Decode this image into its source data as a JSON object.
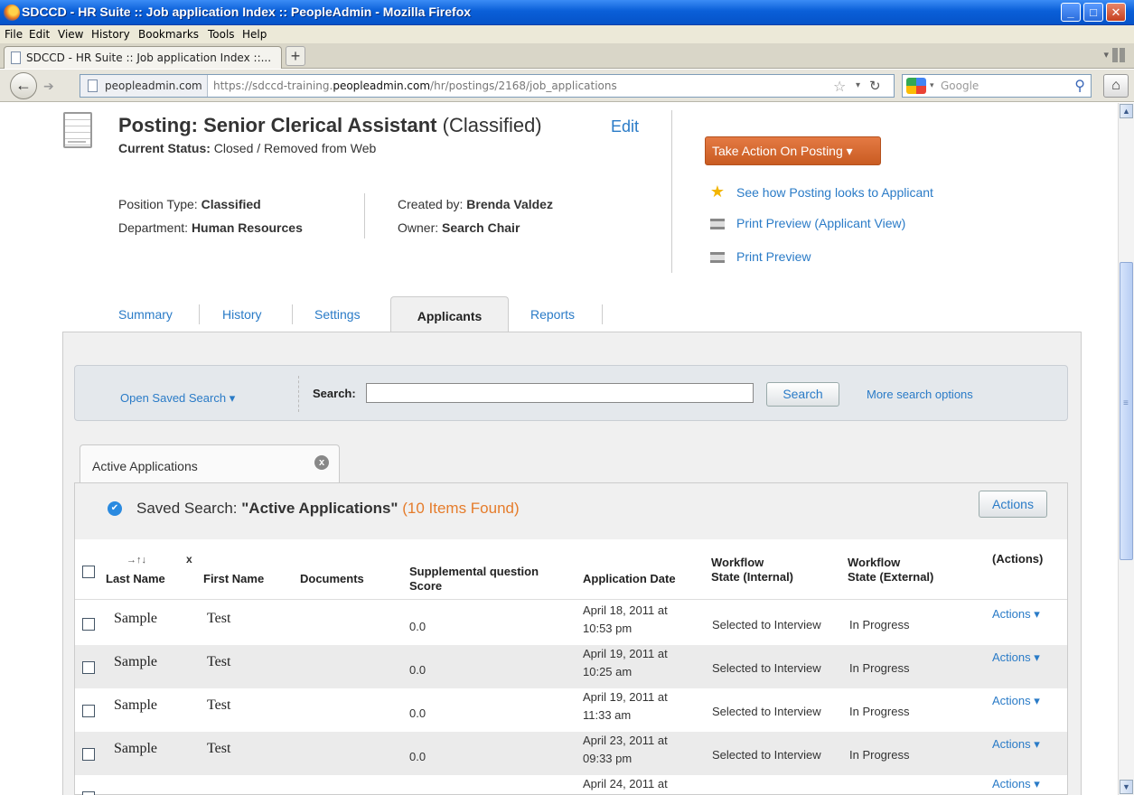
{
  "window": {
    "title": "SDCCD - HR Suite :: Job application Index :: PeopleAdmin - Mozilla Firefox",
    "min": "_",
    "max": "□",
    "close": "✕"
  },
  "menu": [
    "File",
    "Edit",
    "View",
    "History",
    "Bookmarks",
    "Tools",
    "Help"
  ],
  "browser_tab": {
    "label": "SDCCD - HR Suite :: Job application Index ::...",
    "new_tab": "+"
  },
  "nav": {
    "domain": "peopleadmin.com",
    "url_pre": "https://sdccd-training.",
    "url_host": "peopleadmin.com",
    "url_path": "/hr/postings/2168/job_applications",
    "search_placeholder": "Google"
  },
  "posting": {
    "title_prefix": "Posting: Senior Clerical Assistant",
    "title_suffix": " (Classified)",
    "edit": "Edit",
    "status_label": "Current Status:",
    "status_value": " Closed / Removed from Web",
    "position_type_label": "Position Type: ",
    "position_type": "Classified",
    "department_label": "Department: ",
    "department": "Human Resources",
    "created_by_label": "Created by: ",
    "created_by": "Brenda Valdez",
    "owner_label": "Owner: ",
    "owner": "Search Chair"
  },
  "side": {
    "take_action": "Take Action On Posting ▾",
    "links": [
      "See how Posting looks to Applicant",
      "Print Preview (Applicant View)",
      "Print Preview"
    ]
  },
  "tabs": [
    "Summary",
    "History",
    "Settings",
    "Applicants",
    "Reports"
  ],
  "search": {
    "open_saved": "Open Saved Search ▾",
    "label": "Search:",
    "value": "",
    "button": "Search",
    "more": "More search options"
  },
  "saved_tab": {
    "label": "Active Applications",
    "close": "x"
  },
  "results": {
    "prefix": "Saved Search: ",
    "name": "\"Active Applications\"",
    "count": " (10 Items Found)",
    "actions_button": "Actions"
  },
  "columns": {
    "sort_arrows": "→↑↓",
    "sort_clear": "x",
    "last_name": "Last Name",
    "first_name": "First Name",
    "documents": "Documents",
    "supp_score_1": "Supplemental question",
    "supp_score_2": "Score",
    "app_date": "Application Date",
    "wf_int_1": "Workflow",
    "wf_int_2": "State (Internal)",
    "wf_ext_1": "Workflow",
    "wf_ext_2": "State (External)",
    "actions": "(Actions)"
  },
  "rows": [
    {
      "last": "Sample",
      "first": "Test",
      "documents": "",
      "score": "0.0",
      "date1": "April 18, 2011 at",
      "date2": "10:53 pm",
      "wf_int": "Selected to Interview",
      "wf_ext": "In Progress",
      "action": "Actions ▾"
    },
    {
      "last": "Sample",
      "first": "Test",
      "documents": "",
      "score": "0.0",
      "date1": "April 19, 2011 at",
      "date2": "10:25 am",
      "wf_int": "Selected to Interview",
      "wf_ext": "In Progress",
      "action": "Actions ▾"
    },
    {
      "last": "Sample",
      "first": "Test",
      "documents": "",
      "score": "0.0",
      "date1": "April 19, 2011 at",
      "date2": "11:33 am",
      "wf_int": "Selected to Interview",
      "wf_ext": "In Progress",
      "action": "Actions ▾"
    },
    {
      "last": "Sample",
      "first": "Test",
      "documents": "",
      "score": "0.0",
      "date1": "April 23, 2011 at",
      "date2": "09:33 pm",
      "wf_int": "Selected to Interview",
      "wf_ext": "In Progress",
      "action": "Actions ▾"
    },
    {
      "last": "",
      "first": "",
      "documents": "",
      "score": "",
      "date1": "April 24, 2011 at",
      "date2": "",
      "wf_int": "",
      "wf_ext": "",
      "action": "Actions ▾"
    }
  ]
}
